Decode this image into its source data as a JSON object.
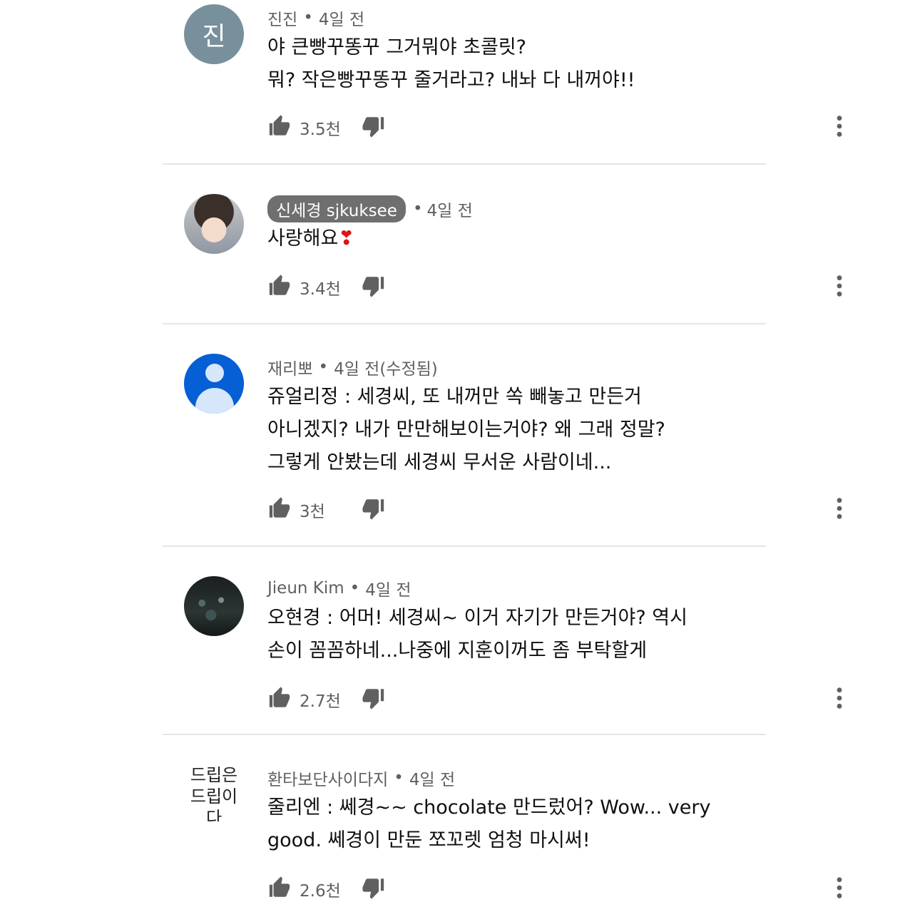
{
  "comments": [
    {
      "avatar_letter": "진",
      "author": "진진",
      "time": "4일 전",
      "text_lines": [
        "야 큰빵꾸똥꾸 그거뭐야 초콜릿?",
        "뭐? 작은빵꾸똥꾸 줄거라고? 내놔 다 내꺼야!!"
      ],
      "likes": "3.5천"
    },
    {
      "author": "신세경 sjkuksee",
      "time": "4일 전",
      "text_lines": [
        "사랑해요"
      ],
      "emoji": "❣",
      "likes": "3.4천"
    },
    {
      "author": "재리뽀",
      "time": "4일 전(수정됨)",
      "text_lines": [
        "쥬얼리정 : 세경씨, 또 내꺼만 쏙 빼놓고 만든거",
        "아니겠지? 내가 만만해보이는거야? 왜 그래 정말?",
        "그렇게 안봤는데 세경씨 무서운 사람이네..."
      ],
      "likes": "3천"
    },
    {
      "author": "Jieun Kim",
      "time": "4일 전",
      "text_lines": [
        "오현경 : 어머! 세경씨~ 이거 자기가 만든거야? 역시",
        "손이 꼼꼼하네...나중에 지훈이꺼도 좀 부탁할게"
      ],
      "likes": "2.7천"
    },
    {
      "avatar_text": [
        "드립은",
        "드립이다"
      ],
      "author": "환타보단사이다지",
      "time": "4일 전",
      "text_lines": [
        "줄리엔 : 쎄경~~ chocolate 만드렀어? Wow... very",
        "good. 쎄경이 만둔 쪼꼬렛 엄청 마시써!"
      ],
      "likes": "2.6천"
    }
  ],
  "separator": "•",
  "icons": {
    "like": "thumbs-up-icon",
    "dislike": "thumbs-down-icon",
    "more": "more-vert-icon"
  }
}
